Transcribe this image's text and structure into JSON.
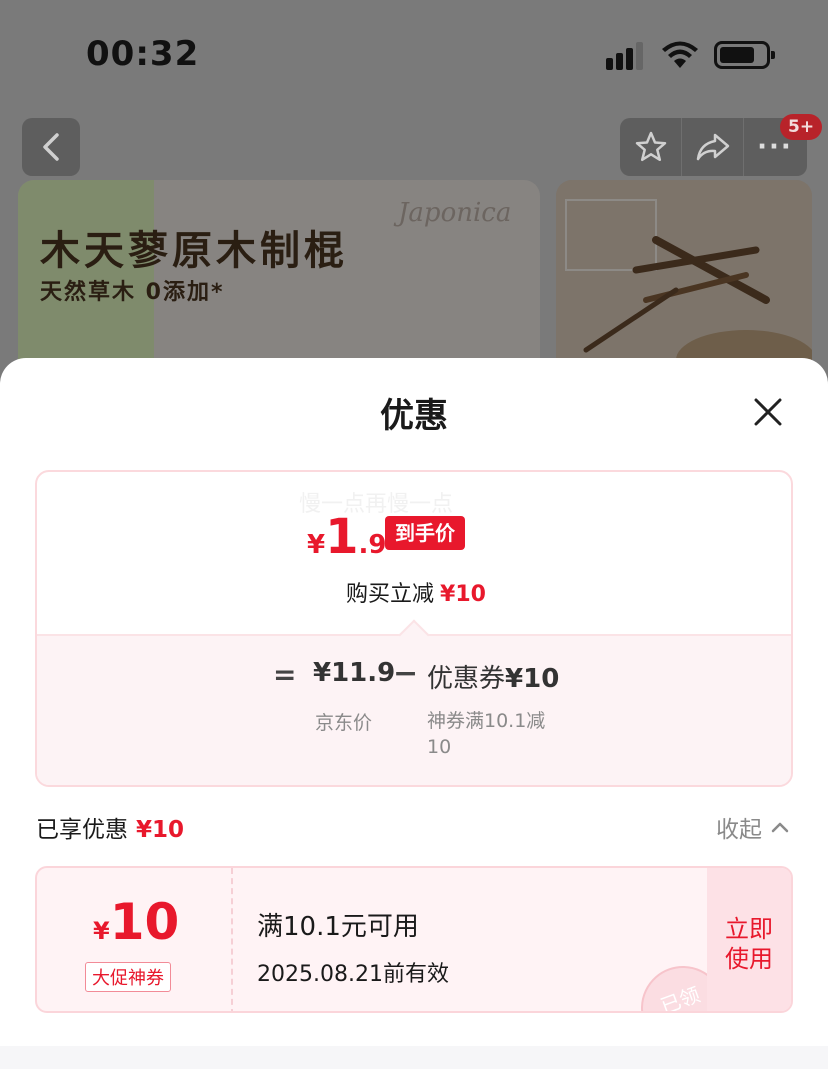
{
  "status_bar": {
    "time": "00:32"
  },
  "header": {
    "cart_badge": "5+"
  },
  "banner": {
    "title": "木天蓼原木制棍",
    "subtitle": "天然草木 0添加*",
    "decor_text": "Japonica"
  },
  "sheet": {
    "title": "优惠",
    "watermark": "慢一点再慢一点",
    "final_price": {
      "currency": "¥",
      "integer": "1",
      "decimal": ".9",
      "tag": "到手价"
    },
    "instant_discount": {
      "label": "购买立减",
      "value": "¥10"
    },
    "calculation": {
      "equals": "=",
      "price": "¥11.9",
      "price_label": "京东价",
      "minus": "−",
      "coupon_label": "优惠券",
      "coupon_value": "¥10",
      "coupon_desc": "神券满10.1减10"
    },
    "enjoyed": {
      "label": "已享优惠",
      "value": "¥10"
    },
    "collapse_label": "收起",
    "coupon": {
      "currency": "¥",
      "amount": "10",
      "tag": "大促神券",
      "condition": "满10.1元可用",
      "validity": "2025.08.21前有效",
      "button": "立即使用",
      "stamp": "已领"
    }
  },
  "colors": {
    "accent": "#e8182c",
    "coupon_bg": "#fff3f5"
  }
}
